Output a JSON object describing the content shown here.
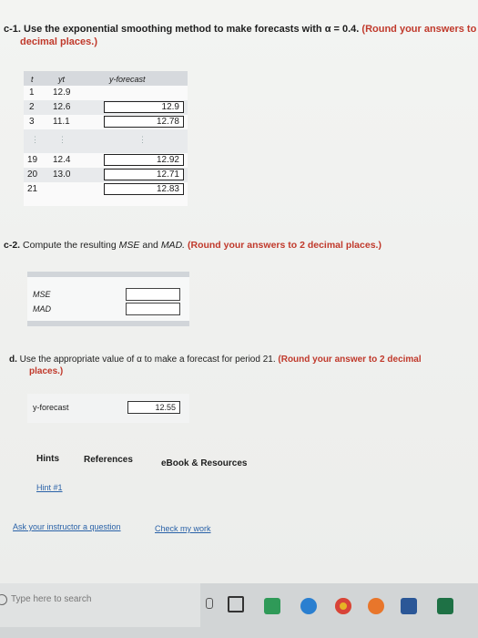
{
  "c1": {
    "label": "c-1.",
    "text": "Use the exponential smoothing method to make forecasts with α = 0.4.",
    "note_l1": "(Round your answers to",
    "note_l2": "decimal places.)",
    "headers": {
      "t": "t",
      "y": "yt",
      "f": "y-forecast"
    },
    "rows": [
      {
        "t": "1",
        "y": "12.9",
        "f": ""
      },
      {
        "t": "2",
        "y": "12.6",
        "f": "12.9"
      },
      {
        "t": "3",
        "y": "11.1",
        "f": "12.78"
      },
      {
        "t": "19",
        "y": "12.4",
        "f": "12.92"
      },
      {
        "t": "20",
        "y": "13.0",
        "f": "12.71"
      },
      {
        "t": "21",
        "y": "",
        "f": "12.83"
      }
    ],
    "ellipsis": "⋮"
  },
  "c2": {
    "label": "c-2.",
    "text_pre": "Compute the resulting",
    "mse_word": "MSE",
    "and": "and",
    "mad_word": "MAD.",
    "note": "(Round your answers to 2 decimal places.)",
    "labels": {
      "mse": "MSE",
      "mad": "MAD"
    },
    "values": {
      "mse": "",
      "mad": ""
    }
  },
  "d": {
    "label": "d.",
    "text_l1": "Use the appropriate value of α to make a forecast for period 21.",
    "note_l1": "(Round your answer to 2 decimal",
    "note_l2": "places.)",
    "yf_label": "y-forecast",
    "yf_value": "12.55"
  },
  "tabs": {
    "hints": "Hints",
    "references": "References",
    "ebook": "eBook & Resources"
  },
  "links": {
    "hint1": "Hint #1",
    "ask": "Ask your instructor a question",
    "check": "Check my work"
  },
  "taskbar": {
    "search_placeholder": "Type here to search"
  }
}
